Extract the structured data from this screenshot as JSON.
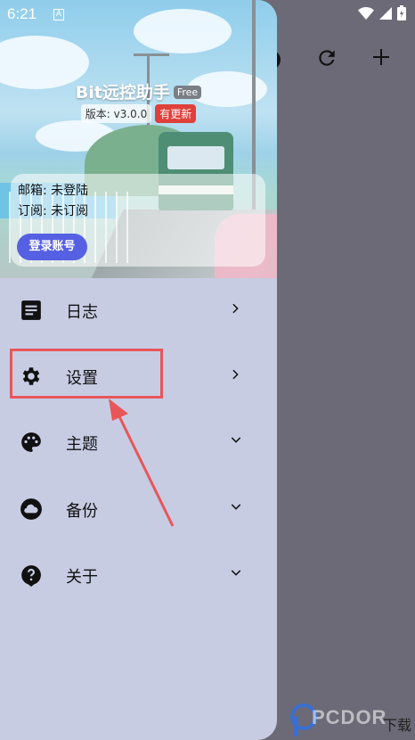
{
  "status_bar": {
    "time": "6:21",
    "notif_icon_letter": "A"
  },
  "app": {
    "title": "Bit远控助手",
    "edition_badge": "Free",
    "version": "版本: v3.0.0",
    "update_badge": "有更新"
  },
  "account": {
    "email": "邮箱: 未登陆",
    "subscription": "订阅: 未订阅",
    "login_button": "登录账号"
  },
  "menu": [
    {
      "label": "日志",
      "icon": "log-icon",
      "arrow": "chevron-right"
    },
    {
      "label": "设置",
      "icon": "gear-icon",
      "arrow": "chevron-right"
    },
    {
      "label": "主题",
      "icon": "palette-icon",
      "arrow": "chevron-down"
    },
    {
      "label": "备份",
      "icon": "cloud-icon",
      "arrow": "chevron-down"
    },
    {
      "label": "关于",
      "icon": "help-icon",
      "arrow": "chevron-down"
    }
  ],
  "background_toolbar": {
    "refresh_icon": "refresh-icon",
    "add_icon": "add-icon"
  },
  "watermark": {
    "text": "PCDOR",
    "cn": "下载"
  },
  "colors": {
    "drawer_bg": "#c7cce3",
    "login_button": "#5660e3",
    "update_badge": "#e0403a",
    "highlight": "#e8565a",
    "scrim": "#6c6a76"
  }
}
